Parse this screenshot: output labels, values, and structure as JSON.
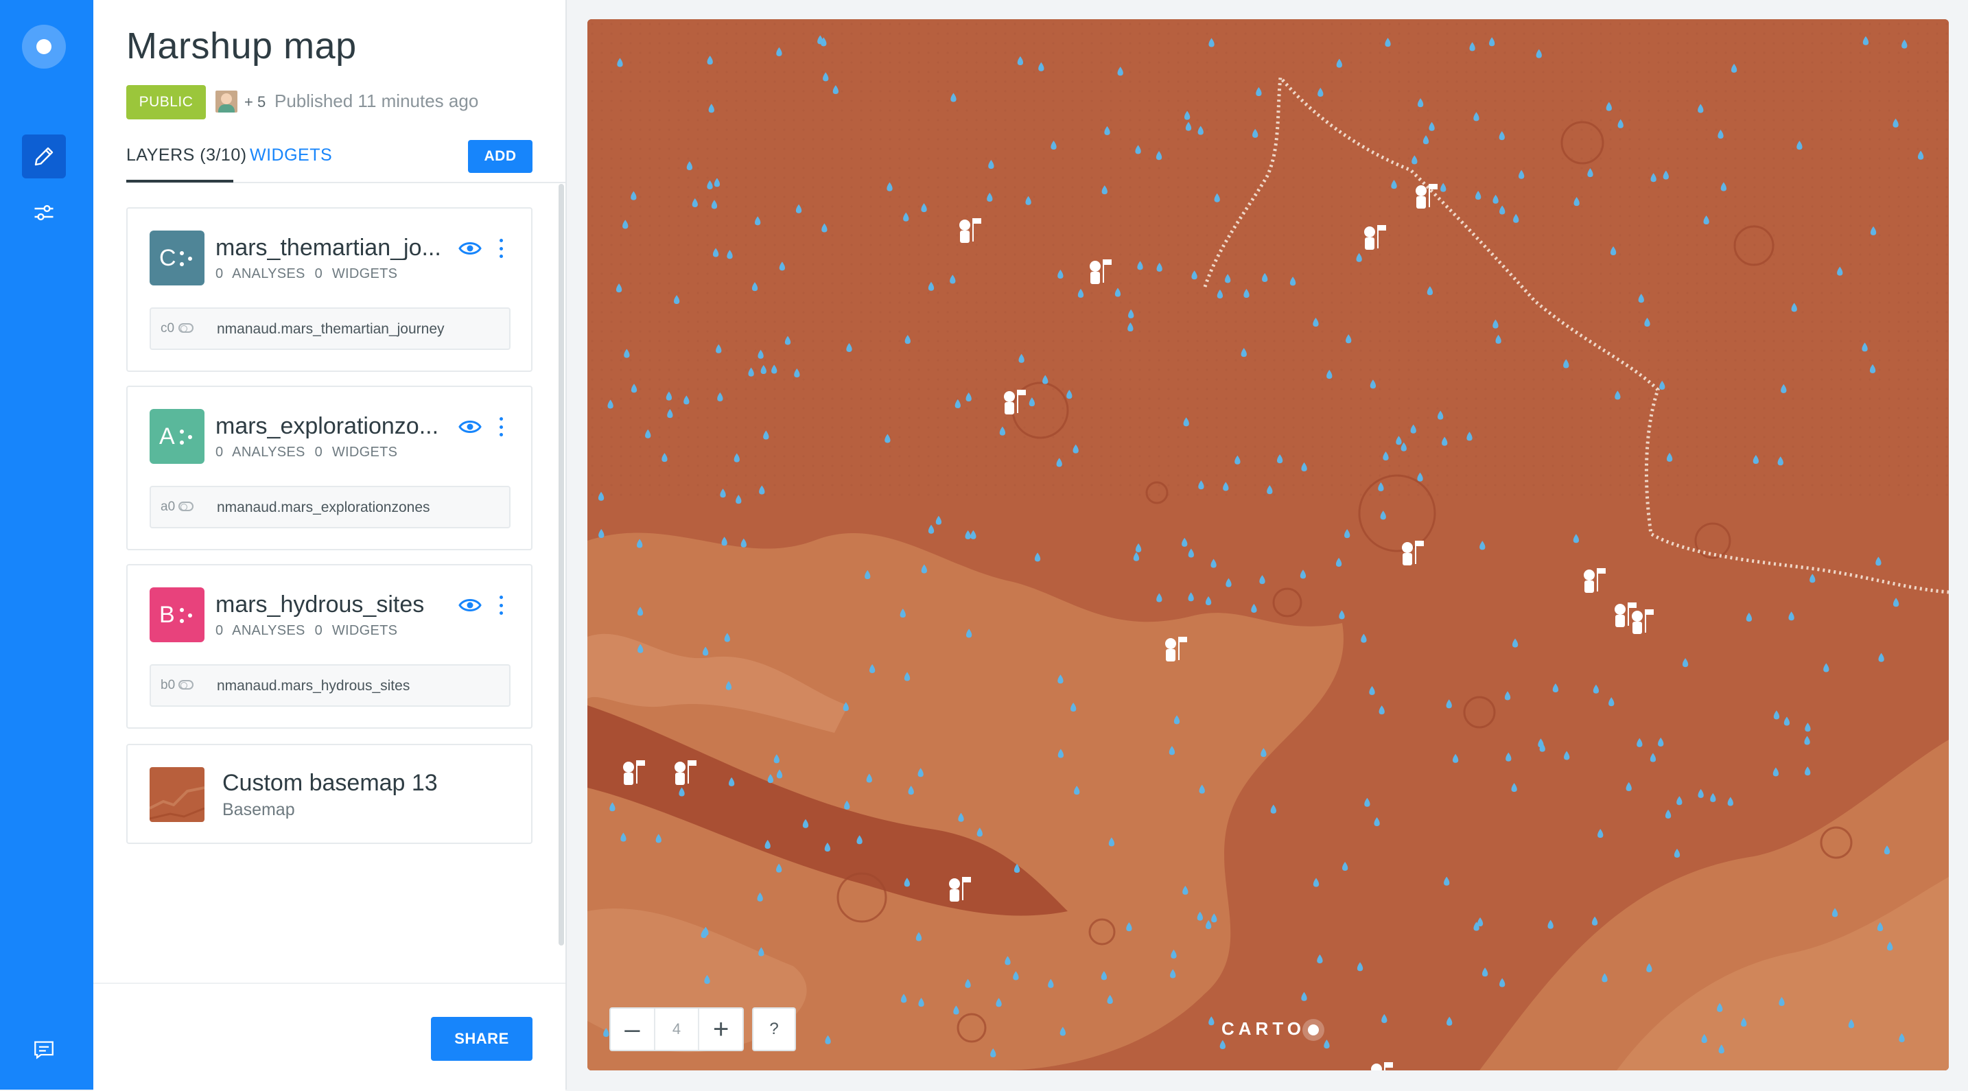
{
  "app": {
    "title": "Marshup map",
    "visibility": "PUBLIC",
    "collaborators": "+ 5",
    "published": "Published 11 minutes ago"
  },
  "tabs": {
    "layers": "LAYERS (3/10)",
    "widgets": "WIDGETS",
    "add": "ADD"
  },
  "layers": [
    {
      "letter": "C",
      "name": "mars_themartian_jo...",
      "analyses": "0 ANALYSES",
      "widgets": "0 WIDGETS",
      "source_id": "c0",
      "source": "nmanaud.mars_themartian_journey",
      "color": "#4f8597"
    },
    {
      "letter": "A",
      "name": "mars_explorationzo...",
      "analyses": "0 ANALYSES",
      "widgets": "0 WIDGETS",
      "source_id": "a0",
      "source": "nmanaud.mars_explorationzones",
      "color": "#5ab89b"
    },
    {
      "letter": "B",
      "name": "mars_hydrous_sites",
      "analyses": "0 ANALYSES",
      "widgets": "0 WIDGETS",
      "source_id": "b0",
      "source": "nmanaud.mars_hydrous_sites",
      "color": "#e8427c"
    }
  ],
  "basemap": {
    "name": "Custom basemap 13",
    "label": "Basemap"
  },
  "footer": {
    "share": "SHARE"
  },
  "map": {
    "zoom_level": "4",
    "help": "?",
    "attribution": "CARTO",
    "base_color": "#b7603f",
    "point_color": "#5fb4e6"
  }
}
